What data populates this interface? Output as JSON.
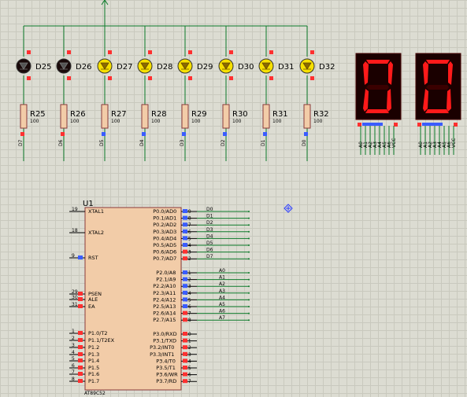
{
  "colors": {
    "wire": "#0d7a2a",
    "body": "#f2cca8",
    "body_stroke": "#8a3a3a",
    "led_on": "#f6e000",
    "led_off": "#1a0a0a",
    "seg_on": "#ff1a1a",
    "seg_bg": "#1a0000",
    "pin_red": "#ff3030",
    "pin_blue": "#3a5cff"
  },
  "leds": [
    {
      "ref": "D25",
      "state": "off"
    },
    {
      "ref": "D26",
      "state": "off"
    },
    {
      "ref": "D27",
      "state": "on"
    },
    {
      "ref": "D28",
      "state": "on"
    },
    {
      "ref": "D29",
      "state": "on"
    },
    {
      "ref": "D30",
      "state": "on"
    },
    {
      "ref": "D31",
      "state": "on"
    },
    {
      "ref": "D32",
      "state": "on"
    }
  ],
  "resistors": [
    {
      "ref": "R25",
      "value": "100",
      "net": "D7"
    },
    {
      "ref": "R26",
      "value": "100",
      "net": "D6"
    },
    {
      "ref": "R27",
      "value": "100",
      "net": "D5"
    },
    {
      "ref": "R28",
      "value": "100",
      "net": "D4"
    },
    {
      "ref": "R29",
      "value": "100",
      "net": "D3"
    },
    {
      "ref": "R30",
      "value": "100",
      "net": "D2"
    },
    {
      "ref": "R31",
      "value": "100",
      "net": "D1"
    },
    {
      "ref": "R32",
      "value": "100",
      "net": "D0"
    }
  ],
  "displays": [
    {
      "digit": "0",
      "pins": [
        "A0",
        "A1",
        "A2",
        "A3",
        "A4",
        "A5",
        "A6",
        "VCC"
      ]
    },
    {
      "digit": "0",
      "pins": [
        "A0",
        "A1",
        "A2",
        "A3",
        "A4",
        "A5",
        "A6",
        "VCC"
      ]
    }
  ],
  "mcu": {
    "ref": "U1",
    "part": "AT89C52",
    "left_pins": [
      {
        "num": "19",
        "name": "XTAL1"
      },
      {
        "num": "18",
        "name": "XTAL2"
      },
      {
        "num": "9",
        "name": "RST"
      },
      {
        "num": "29",
        "name": "PSEN"
      },
      {
        "num": "30",
        "name": "ALE"
      },
      {
        "num": "31",
        "name": "EA"
      },
      {
        "num": "1",
        "name": "P1.0/T2"
      },
      {
        "num": "2",
        "name": "P1.1/T2EX"
      },
      {
        "num": "3",
        "name": "P1.2"
      },
      {
        "num": "4",
        "name": "P1.3"
      },
      {
        "num": "5",
        "name": "P1.4"
      },
      {
        "num": "6",
        "name": "P1.5"
      },
      {
        "num": "7",
        "name": "P1.6"
      },
      {
        "num": "8",
        "name": "P1.7"
      }
    ],
    "right_pins": [
      {
        "num": "39",
        "name": "P0.0/AD0",
        "net": "D0"
      },
      {
        "num": "38",
        "name": "P0.1/AD1",
        "net": "D1"
      },
      {
        "num": "37",
        "name": "P0.2/AD2",
        "net": "D2"
      },
      {
        "num": "36",
        "name": "P0.3/AD3",
        "net": "D3"
      },
      {
        "num": "35",
        "name": "P0.4/AD4",
        "net": "D4"
      },
      {
        "num": "34",
        "name": "P0.5/AD5",
        "net": "D5"
      },
      {
        "num": "33",
        "name": "P0.6/AD6",
        "net": "D6"
      },
      {
        "num": "32",
        "name": "P0.7/AD7",
        "net": "D7"
      },
      {
        "num": "21",
        "name": "P2.0/A8",
        "net": "A0"
      },
      {
        "num": "22",
        "name": "P2.1/A9",
        "net": "A1"
      },
      {
        "num": "23",
        "name": "P2.2/A10",
        "net": "A2"
      },
      {
        "num": "24",
        "name": "P2.3/A11",
        "net": "A3"
      },
      {
        "num": "25",
        "name": "P2.4/A12",
        "net": "A4"
      },
      {
        "num": "26",
        "name": "P2.5/A13",
        "net": "A5"
      },
      {
        "num": "27",
        "name": "P2.6/A14",
        "net": "A6"
      },
      {
        "num": "28",
        "name": "P2.7/A15",
        "net": "A7"
      },
      {
        "num": "10",
        "name": "P3.0/RXD"
      },
      {
        "num": "11",
        "name": "P3.1/TXD"
      },
      {
        "num": "12",
        "name": "P3.2/INT0"
      },
      {
        "num": "13",
        "name": "P3.3/INT1"
      },
      {
        "num": "14",
        "name": "P3.4/T0"
      },
      {
        "num": "15",
        "name": "P3.5/T1"
      },
      {
        "num": "16",
        "name": "P3.6/WR"
      },
      {
        "num": "17",
        "name": "P3.7/RD"
      }
    ]
  }
}
